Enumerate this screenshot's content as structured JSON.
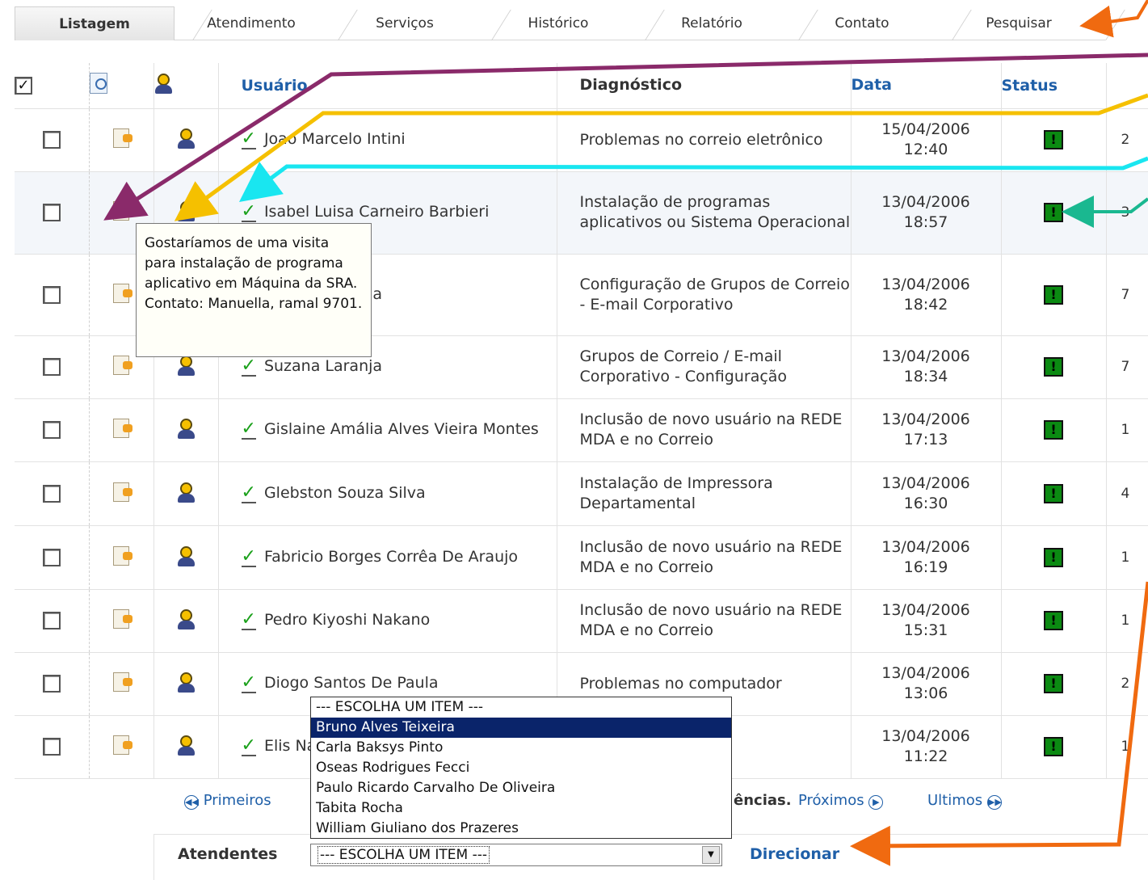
{
  "tabs": [
    "Listagem",
    "Atendimento",
    "Serviços",
    "Histórico",
    "Relatório",
    "Contato",
    "Pesquisar"
  ],
  "table": {
    "headers": {
      "user": "Usuário",
      "diagnostic": "Diagnóstico",
      "date": "Data",
      "status": "Status"
    },
    "rows": [
      {
        "user": "Joao Marcelo Intini",
        "diag": "Problemas no correio eletrônico",
        "date": "15/04/2006",
        "time": "12:40",
        "num": "2"
      },
      {
        "user": "Isabel Luisa Carneiro Barbieri",
        "diag": "Instalação de programas aplicativos ou Sistema Operacional",
        "date": "13/04/2006",
        "time": "18:57",
        "num": "3"
      },
      {
        "user": "Suzana Laranja",
        "diag": "Configuração de Grupos de Correio - E-mail Corporativo",
        "date": "13/04/2006",
        "time": "18:42",
        "num": "7"
      },
      {
        "user": "Suzana Laranja",
        "diag": "Grupos de Correio / E-mail Corporativo - Configuração",
        "date": "13/04/2006",
        "time": "18:34",
        "num": "7"
      },
      {
        "user": "Gislaine Amália Alves Vieira Montes",
        "diag": "Inclusão de novo usuário na REDE MDA e no Correio",
        "date": "13/04/2006",
        "time": "17:13",
        "num": "1"
      },
      {
        "user": "Glebston Souza Silva",
        "diag": "Instalação de Impressora Departamental",
        "date": "13/04/2006",
        "time": "16:30",
        "num": "4"
      },
      {
        "user": "Fabricio Borges Corrêa De Araujo",
        "diag": "Inclusão de novo usuário na REDE MDA e no Correio",
        "date": "13/04/2006",
        "time": "16:19",
        "num": "1"
      },
      {
        "user": "Pedro Kiyoshi Nakano",
        "diag": "Inclusão de novo usuário na REDE MDA e no Correio",
        "date": "13/04/2006",
        "time": "15:31",
        "num": "1"
      },
      {
        "user": "Diogo Santos De Paula",
        "diag": "Problemas no computador",
        "date": "13/04/2006",
        "time": "13:06",
        "num": "2"
      },
      {
        "user": "Elis Nascimento",
        "diag": "",
        "date": "13/04/2006",
        "time": "11:22",
        "num": "1"
      }
    ]
  },
  "tooltip": {
    "text": "Gostaríamos de uma visita para instalação de programa aplicativo em Máquina da SRA. Contato: Manuella, ramal 9701."
  },
  "pager": {
    "first": "Primeiros",
    "middle": "ências.",
    "next": "Próximos",
    "last": "Ultimos"
  },
  "footer": {
    "atendentes_label": "Atendentes",
    "select_value": "--- ESCOLHA UM ITEM ---",
    "direcionar": "Direcionar"
  },
  "dropdown": {
    "options": [
      "--- ESCOLHA UM ITEM ---",
      "Bruno Alves Teixeira",
      "Carla Baksys Pinto",
      "Oseas Rodrigues Fecci",
      "Paulo Ricardo Carvalho De Oliveira",
      "Tabita Rocha",
      "William Giuliano dos Prazeres"
    ],
    "selected": "Bruno Alves Teixeira"
  },
  "colors": {
    "link": "#1f5fa8",
    "status_green": "#0b8a12",
    "arrow_purple": "#8a2a6a",
    "arrow_yellow": "#f5c000",
    "arrow_cyan": "#19e6f0",
    "arrow_teal": "#1ab890",
    "arrow_orange": "#f06a10",
    "dropdown_highlight": "#0a246a"
  }
}
